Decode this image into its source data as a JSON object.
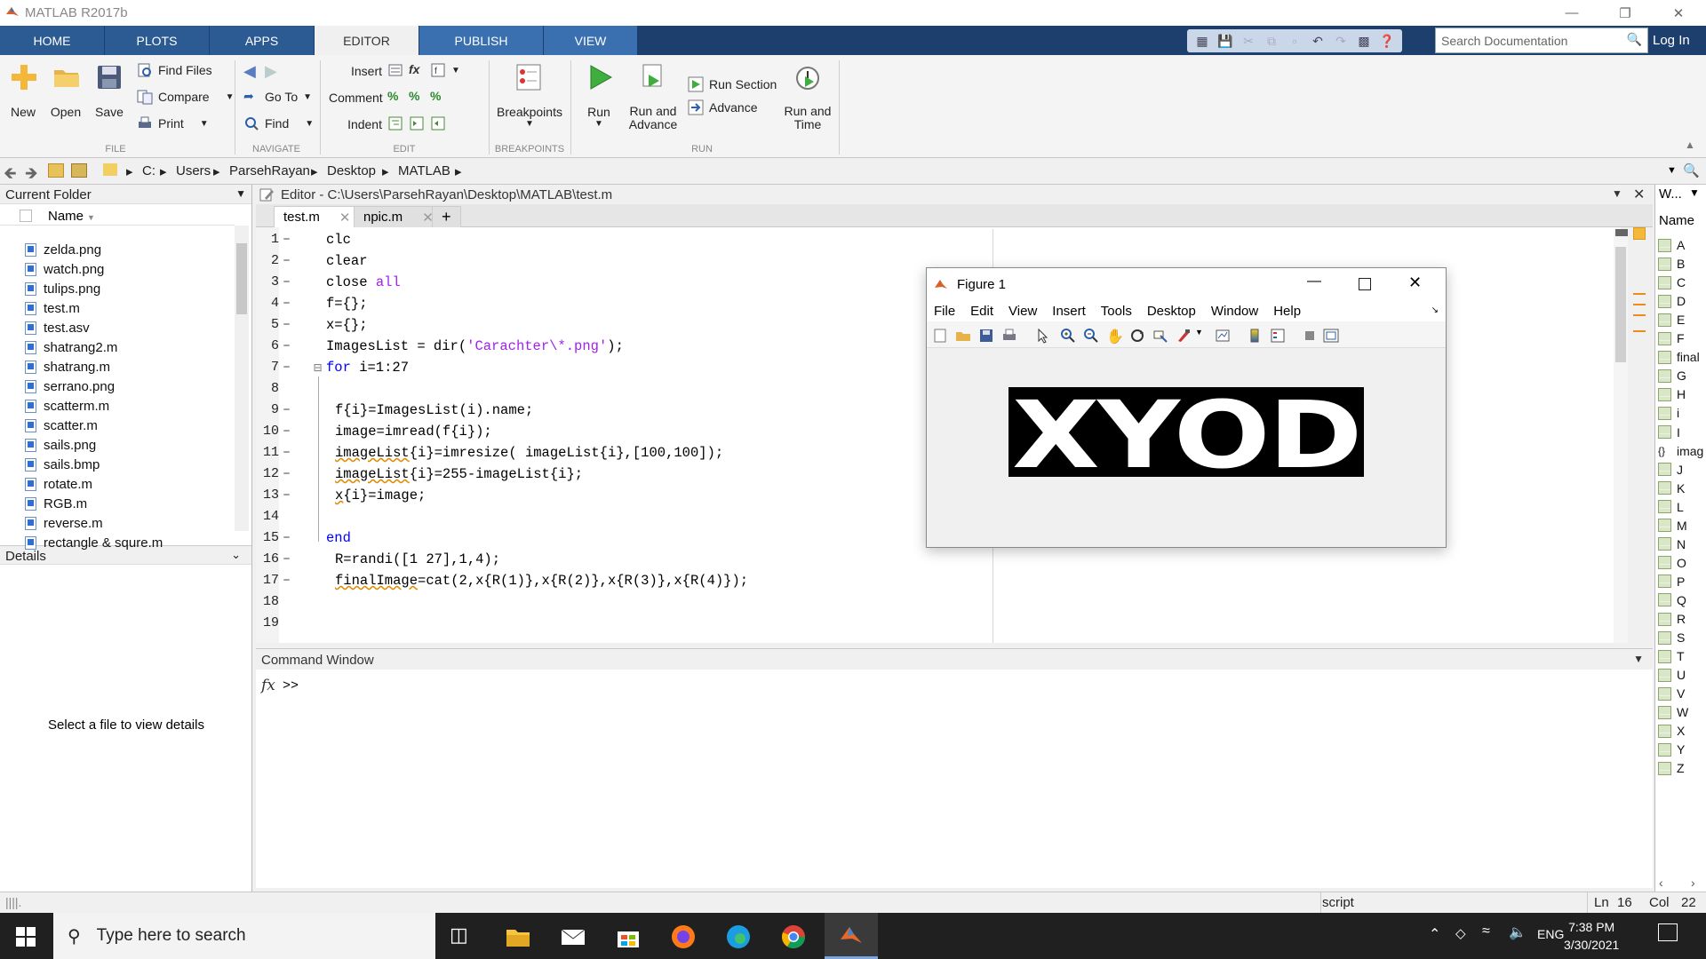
{
  "window": {
    "title": "MATLAB R2017b"
  },
  "tabs": [
    "HOME",
    "PLOTS",
    "APPS",
    "EDITOR",
    "PUBLISH",
    "VIEW"
  ],
  "search": {
    "placeholder": "Search Documentation"
  },
  "login": "Log In",
  "ribbon": {
    "file": {
      "new": "New",
      "open": "Open",
      "save": "Save",
      "find_files": "Find Files",
      "compare": "Compare",
      "print": "Print",
      "group": "FILE"
    },
    "navigate": {
      "goto": "Go To",
      "find": "Find",
      "group": "NAVIGATE"
    },
    "edit": {
      "insert": "Insert",
      "comment": "Comment",
      "indent": "Indent",
      "group": "EDIT"
    },
    "breakpoints": {
      "label": "Breakpoints",
      "group": "BREAKPOINTS"
    },
    "run": {
      "run": "Run",
      "run_advance": "Run and\nAdvance",
      "run_section": "Run Section",
      "advance": "Advance",
      "run_time": "Run and\nTime",
      "group": "RUN"
    }
  },
  "path": [
    "C:",
    "Users",
    "ParsehRayan",
    "Desktop",
    "MATLAB"
  ],
  "current_folder": {
    "title": "Current Folder",
    "column": "Name",
    "files": [
      "zelda.png",
      "watch.png",
      "tulips.png",
      "test.m",
      "test.asv",
      "shatrang2.m",
      "shatrang.m",
      "serrano.png",
      "scatterm.m",
      "scatter.m",
      "sails.png",
      "sails.bmp",
      "rotate.m",
      "RGB.m",
      "reverse.m",
      "rectangle & squre.m"
    ]
  },
  "details": {
    "title": "Details",
    "message": "Select a file to view details"
  },
  "editor": {
    "title": "Editor - C:\\Users\\ParsehRayan\\Desktop\\MATLAB\\test.m",
    "tabs": [
      "test.m",
      "npic.m"
    ],
    "line_numbers": [
      "1",
      "2",
      "3",
      "4",
      "5",
      "6",
      "7",
      "8",
      "9",
      "10",
      "11",
      "12",
      "13",
      "14",
      "15",
      "16",
      "17",
      "18",
      "19"
    ]
  },
  "command_window": {
    "title": "Command Window",
    "prompt": ">>",
    "fx": "fx"
  },
  "figure": {
    "title": "Figure 1",
    "menu": [
      "File",
      "Edit",
      "View",
      "Insert",
      "Tools",
      "Desktop",
      "Window",
      "Help"
    ],
    "image_text": "XYOD"
  },
  "workspace": {
    "title": "W...",
    "column": "Name",
    "vars": [
      "A",
      "B",
      "C",
      "D",
      "E",
      "F",
      "final",
      "G",
      "H",
      "i",
      "I",
      "imag",
      "J",
      "K",
      "L",
      "M",
      "N",
      "O",
      "P",
      "Q",
      "R",
      "S",
      "T",
      "U",
      "V",
      "W",
      "X",
      "Y",
      "Z"
    ]
  },
  "status": {
    "mode": "script",
    "ln_label": "Ln",
    "ln": "16",
    "col_label": "Col",
    "col": "22"
  },
  "taskbar": {
    "search": "Type here to search",
    "lang": "ENG",
    "time": "7:38 PM",
    "date": "3/30/2021"
  },
  "colors": {
    "tabstrip": "#1c3f6e",
    "keyword": "#0000ff",
    "string": "#a020f0",
    "taskbar": "#202020"
  }
}
